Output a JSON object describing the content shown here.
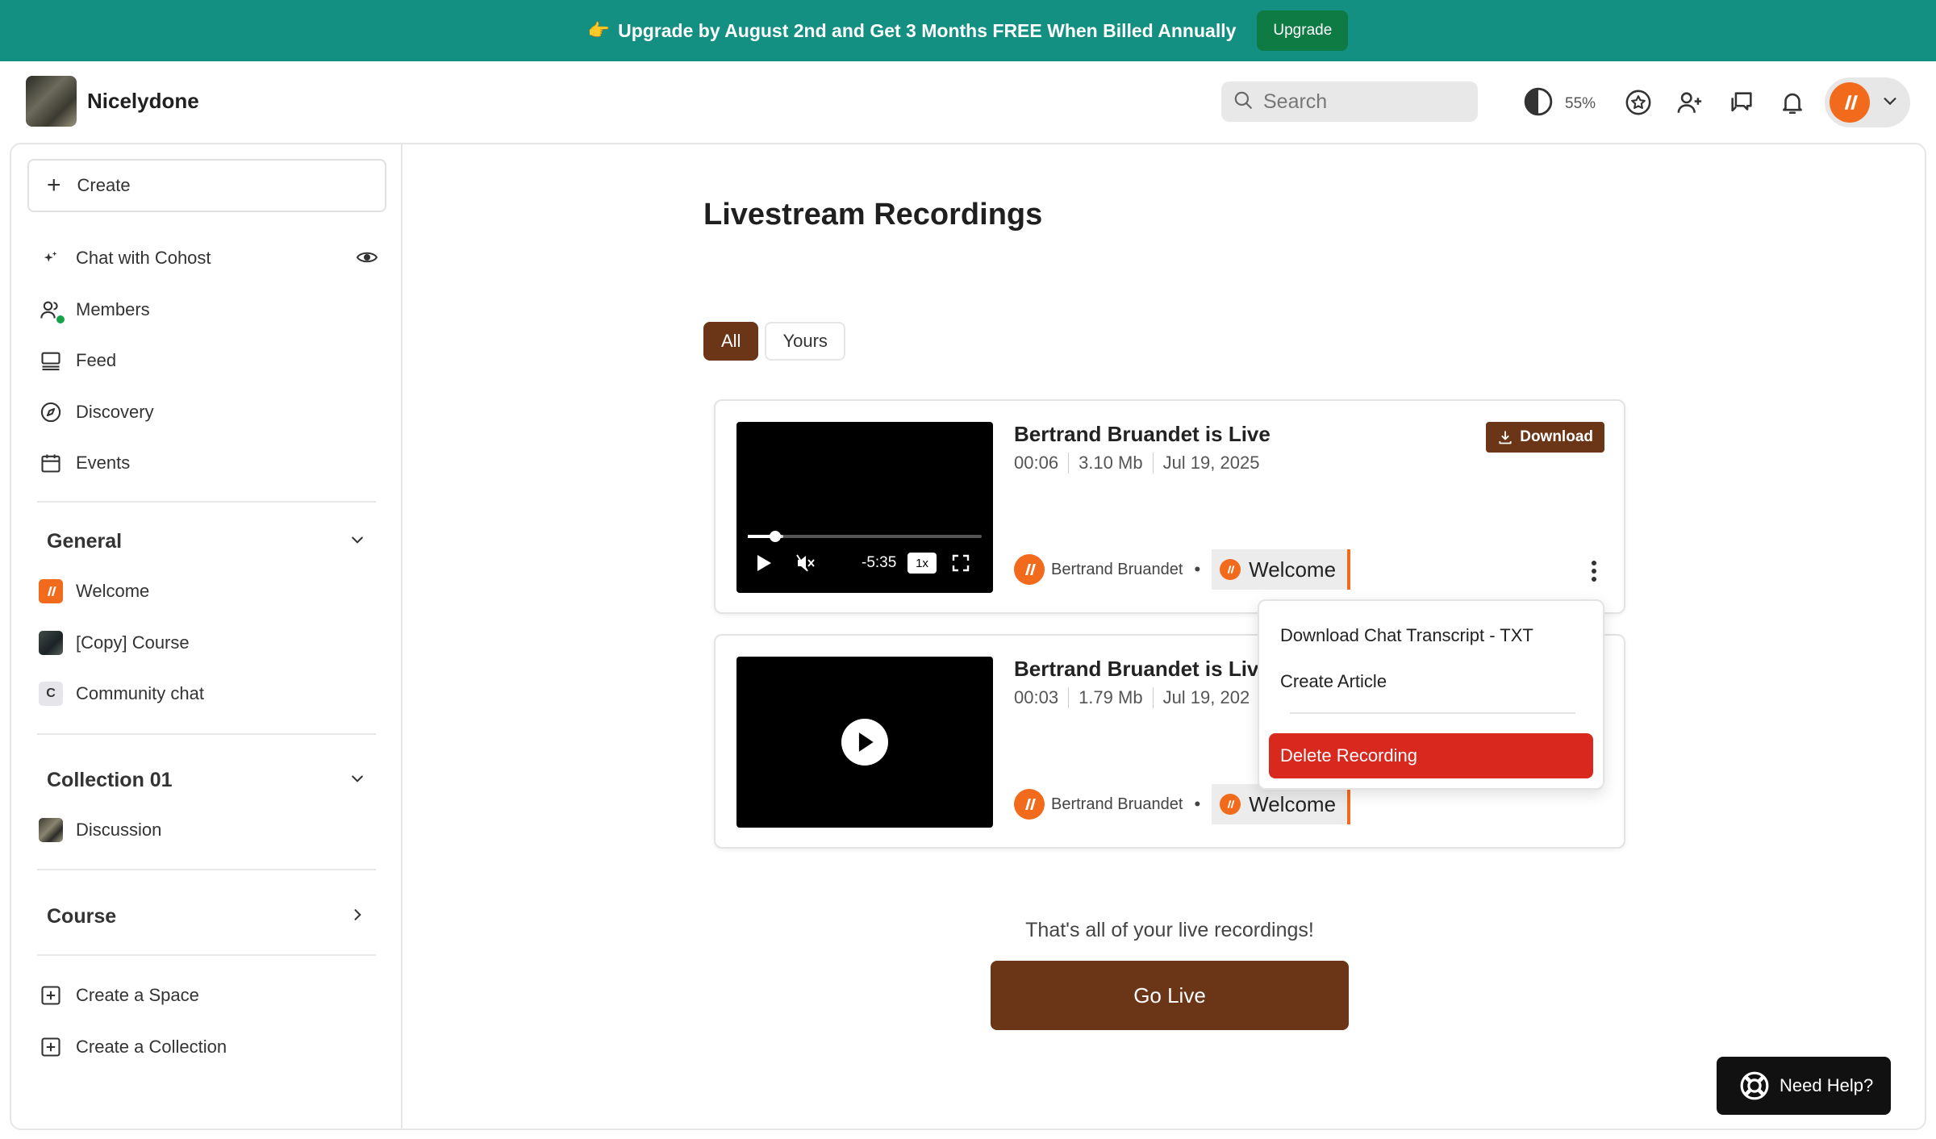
{
  "banner": {
    "message": "Upgrade by August 2nd and Get 3 Months FREE When Billed Annually",
    "upgrade_label": "Upgrade"
  },
  "header": {
    "brand_name": "Nicelydone",
    "search_placeholder": "Search",
    "contrast_percent": "55%"
  },
  "sidebar": {
    "create_label": "Create",
    "items": [
      {
        "label": "Chat with Cohost"
      },
      {
        "label": "Members"
      },
      {
        "label": "Feed"
      },
      {
        "label": "Discovery"
      },
      {
        "label": "Events"
      }
    ],
    "sections": [
      {
        "title": "General",
        "spaces": [
          {
            "label": "Welcome"
          },
          {
            "label": "[Copy] Course"
          },
          {
            "label": "Community chat",
            "letter": "C"
          }
        ]
      },
      {
        "title": "Collection 01",
        "spaces": [
          {
            "label": "Discussion"
          }
        ]
      },
      {
        "title": "Course",
        "spaces": []
      }
    ],
    "create_space_label": "Create a Space",
    "create_collection_label": "Create a Collection"
  },
  "main": {
    "title": "Livestream Recordings",
    "tabs": [
      {
        "label": "All",
        "active": true
      },
      {
        "label": "Yours",
        "active": false
      }
    ],
    "recordings": [
      {
        "title": "Bertrand Bruandet is Live",
        "duration": "00:06",
        "size": "3.10 Mb",
        "date": "Jul 19, 2025",
        "author": "Bertrand Bruandet",
        "space": "Welcome",
        "download_label": "Download",
        "player": {
          "time_remaining": "-5:35",
          "speed": "1x",
          "progress": 0.15
        }
      },
      {
        "title": "Bertrand Bruandet is Live",
        "duration": "00:03",
        "size": "1.79 Mb",
        "date": "Jul 19, 202",
        "author": "Bertrand Bruandet",
        "space": "Welcome"
      }
    ],
    "menu": {
      "download_transcript": "Download Chat Transcript - TXT",
      "create_article": "Create Article",
      "delete_recording": "Delete Recording"
    },
    "end_text": "That's all of your live recordings!",
    "go_live_label": "Go Live"
  },
  "help": {
    "label": "Need Help?"
  },
  "colors": {
    "brand_brown": "#6b3517",
    "banner_teal": "#149082",
    "accent_orange": "#f26a1b",
    "danger_red": "#d9281e"
  }
}
